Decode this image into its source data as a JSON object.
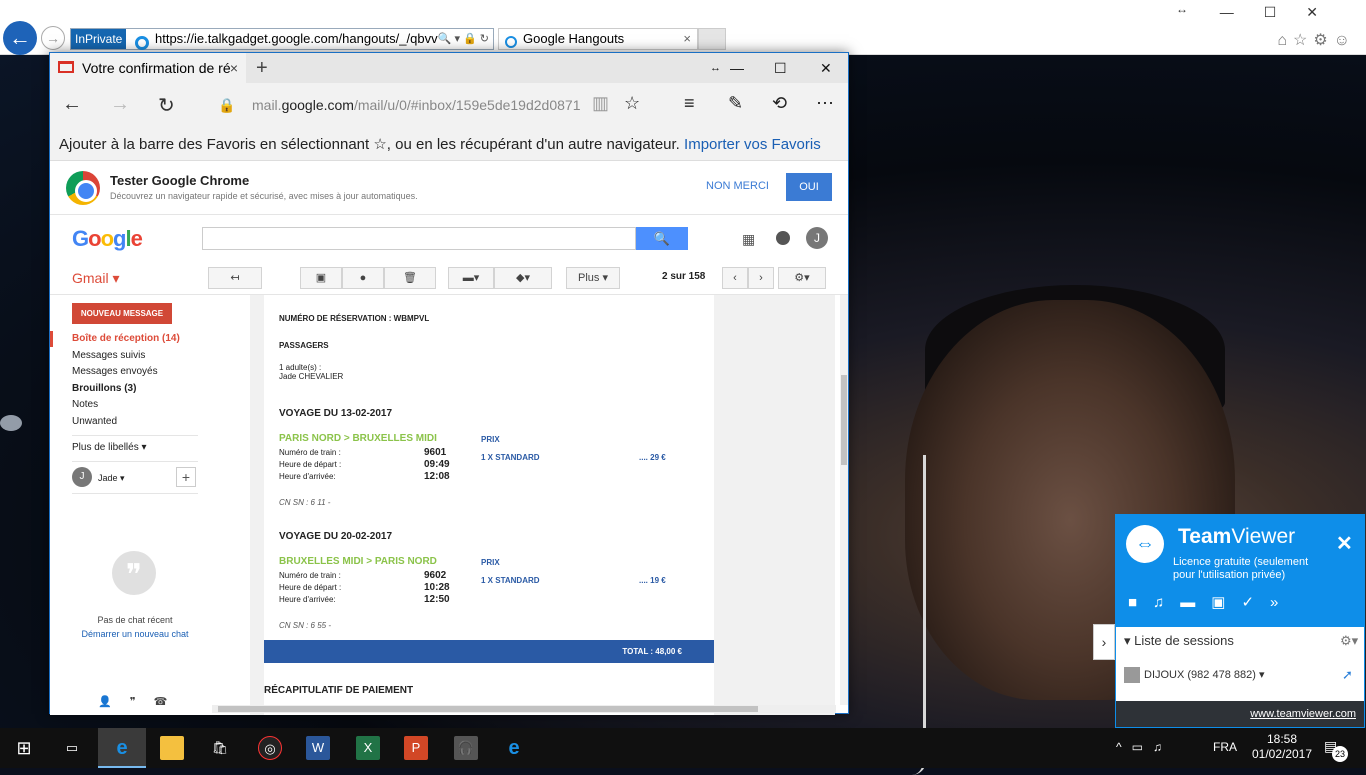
{
  "ie": {
    "inprivate": "InPrivate",
    "url": "https://ie.talkgadget.google.com/hangouts/_/qbvv",
    "tab_title": "Google Hangouts",
    "tab_close": "×"
  },
  "edge": {
    "tab_title": "Votre confirmation de ré",
    "tab_close": "×",
    "new_tab": "+",
    "url_prefix": "mail.",
    "url_domain": "google.com",
    "url_rest": "/mail/u/0/#inbox/159e5de19d2d0871",
    "favbar_text": "Ajouter à la barre des Favoris en sélectionnant ☆, ou en les récupérant d'un autre navigateur. ",
    "favbar_link": "Importer vos Favoris",
    "chrome_title": "Tester Google Chrome",
    "chrome_desc": "Découvrez un navigateur rapide et sécurisé, avec mises à jour automatiques.",
    "chrome_no": "NON MERCI",
    "chrome_yes": "OUI"
  },
  "gmail": {
    "logo": "Google",
    "label": "Gmail ▾",
    "more": "Plus ▾",
    "page_pos": "2 sur 158",
    "compose": "NOUVEAU MESSAGE",
    "folders": [
      "Boîte de réception (14)",
      "Messages suivis",
      "Messages envoyés",
      "Brouillons (3)",
      "Notes",
      "Unwanted"
    ],
    "more_labels": "Plus de libellés ▾",
    "user_initial": "J",
    "user_name": "Jade ▾",
    "no_chat": "Pas de chat récent",
    "start_chat": "Démarrer un nouveau chat",
    "avatar": "J"
  },
  "email": {
    "reservation": "NUMÉRO DE RÉSERVATION : WBMPVL",
    "passengers_h": "PASSAGERS",
    "passengers_count": "1 adulte(s) :",
    "passenger_name": "Jade CHEVALIER",
    "trip1": {
      "title": "VOYAGE DU 13-02-2017",
      "route": "PARIS NORD > BRUXELLES MIDI",
      "price_h": "PRIX",
      "train_lbl": "Numéro de train :",
      "train": "9601",
      "dep_lbl": "Heure de départ :",
      "dep": "09:49",
      "arr_lbl": "Heure d'arrivée:",
      "arr": "12:08",
      "class": "1 X STANDARD",
      "price": ".... 29 €",
      "cn": "CN SN : 6 11 -"
    },
    "trip2": {
      "title": "VOYAGE DU 20-02-2017",
      "route": "BRUXELLES MIDI > PARIS NORD",
      "price_h": "PRIX",
      "train_lbl": "Numéro de train :",
      "train": "9602",
      "dep_lbl": "Heure de départ :",
      "dep": "10:28",
      "arr_lbl": "Heure d'arrivée:",
      "arr": "12:50",
      "class": "1 X STANDARD",
      "price": ".... 19 €",
      "cn": "CN SN : 6 55 -"
    },
    "total": "TOTAL : 48,00 €",
    "recap": "RÉCAPITULATIF DE PAIEMENT"
  },
  "teamviewer": {
    "name_bold": "Team",
    "name_rest": "Viewer",
    "license": "Licence gratuite (seulement pour l'utilisation privée)",
    "sessions": "Liste de sessions",
    "user": "DIJOUX (982 478 882)",
    "link": "www.teamviewer.com",
    "accent": "#0e8ee9"
  },
  "taskbar": {
    "lang": "FRA",
    "time": "18:58",
    "date": "01/02/2017",
    "notif_count": "23"
  }
}
